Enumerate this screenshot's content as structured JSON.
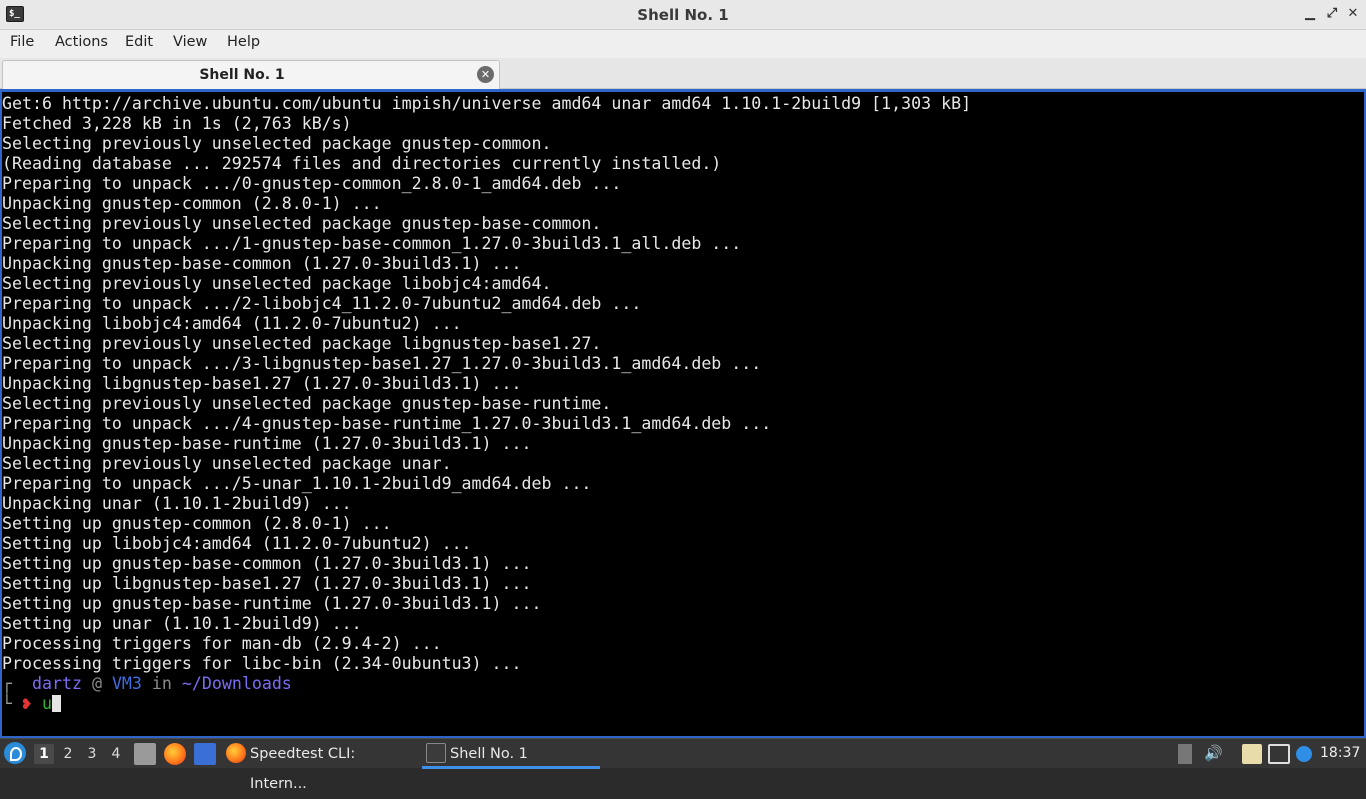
{
  "window": {
    "title": "Shell No. 1",
    "app_icon_glyph": "$_",
    "minimize_glyph": "▁",
    "maximize_glyph": "⤢",
    "close_glyph": "✕"
  },
  "menubar": {
    "items": [
      "File",
      "Actions",
      "Edit",
      "View",
      "Help"
    ]
  },
  "tabs": [
    {
      "label": "Shell No. 1",
      "close_glyph": "✕"
    }
  ],
  "terminal": {
    "lines": [
      "Get:6 http://archive.ubuntu.com/ubuntu impish/universe amd64 unar amd64 1.10.1-2build9 [1,303 kB]",
      "Fetched 3,228 kB in 1s (2,763 kB/s)",
      "Selecting previously unselected package gnustep-common.",
      "(Reading database ... 292574 files and directories currently installed.)",
      "Preparing to unpack .../0-gnustep-common_2.8.0-1_amd64.deb ...",
      "Unpacking gnustep-common (2.8.0-1) ...",
      "Selecting previously unselected package gnustep-base-common.",
      "Preparing to unpack .../1-gnustep-base-common_1.27.0-3build3.1_all.deb ...",
      "Unpacking gnustep-base-common (1.27.0-3build3.1) ...",
      "Selecting previously unselected package libobjc4:amd64.",
      "Preparing to unpack .../2-libobjc4_11.2.0-7ubuntu2_amd64.deb ...",
      "Unpacking libobjc4:amd64 (11.2.0-7ubuntu2) ...",
      "Selecting previously unselected package libgnustep-base1.27.",
      "Preparing to unpack .../3-libgnustep-base1.27_1.27.0-3build3.1_amd64.deb ...",
      "Unpacking libgnustep-base1.27 (1.27.0-3build3.1) ...",
      "Selecting previously unselected package gnustep-base-runtime.",
      "Preparing to unpack .../4-gnustep-base-runtime_1.27.0-3build3.1_amd64.deb ...",
      "Unpacking gnustep-base-runtime (1.27.0-3build3.1) ...",
      "Selecting previously unselected package unar.",
      "Preparing to unpack .../5-unar_1.10.1-2build9_amd64.deb ...",
      "Unpacking unar (1.10.1-2build9) ...",
      "Setting up gnustep-common (2.8.0-1) ...",
      "Setting up libobjc4:amd64 (11.2.0-7ubuntu2) ...",
      "Setting up gnustep-base-common (1.27.0-3build3.1) ...",
      "Setting up libgnustep-base1.27 (1.27.0-3build3.1) ...",
      "Setting up gnustep-base-runtime (1.27.0-3build3.1) ...",
      "Setting up unar (1.10.1-2build9) ...",
      "Processing triggers for man-db (2.9.4-2) ...",
      "Processing triggers for libc-bin (2.34-0ubuntu3) ..."
    ],
    "prompt": {
      "bracket_top": "┌",
      "user": "dartz",
      "at": "@",
      "host": "VM3",
      "in": "in",
      "path": "~/Downloads",
      "bracket_bottom": "└",
      "arrow": "❥",
      "input": "u"
    }
  },
  "taskbar": {
    "workspaces": [
      "1",
      "2",
      "3",
      "4"
    ],
    "active_workspace": "1",
    "tasks": [
      {
        "label": "Speedtest CLI: Intern...",
        "icon": "firefox-icon"
      },
      {
        "label": "Shell No. 1",
        "icon": "terminal-icon"
      }
    ],
    "clock": "18:37",
    "colors": {
      "accent": "#3f8fe6",
      "terminal_border": "#2f64c8",
      "prompt_user": "#7b6cf5",
      "prompt_host": "#3f6de0",
      "prompt_arrow": "#e53333",
      "prompt_input": "#2fb52f"
    }
  }
}
